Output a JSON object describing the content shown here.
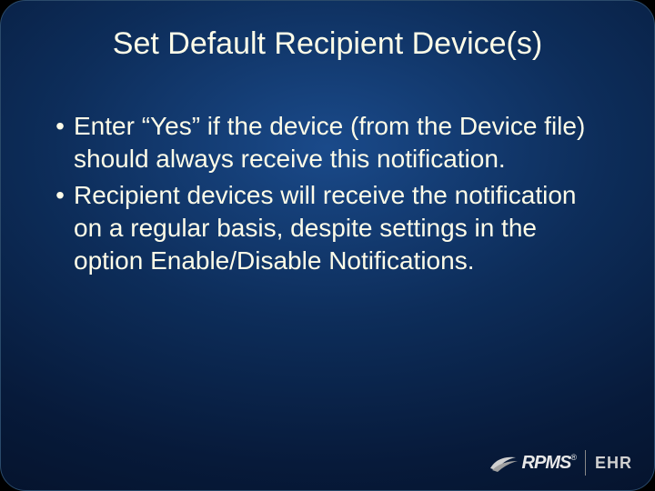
{
  "title": "Set Default Recipient Device(s)",
  "bullets": [
    "Enter “Yes” if the device (from the Device file) should always receive this notification.",
    "Recipient devices will receive the notification on a regular basis, despite settings in the option Enable/Disable Notifications."
  ],
  "footer": {
    "rpms": "RPMS",
    "ehr": "EHR"
  }
}
